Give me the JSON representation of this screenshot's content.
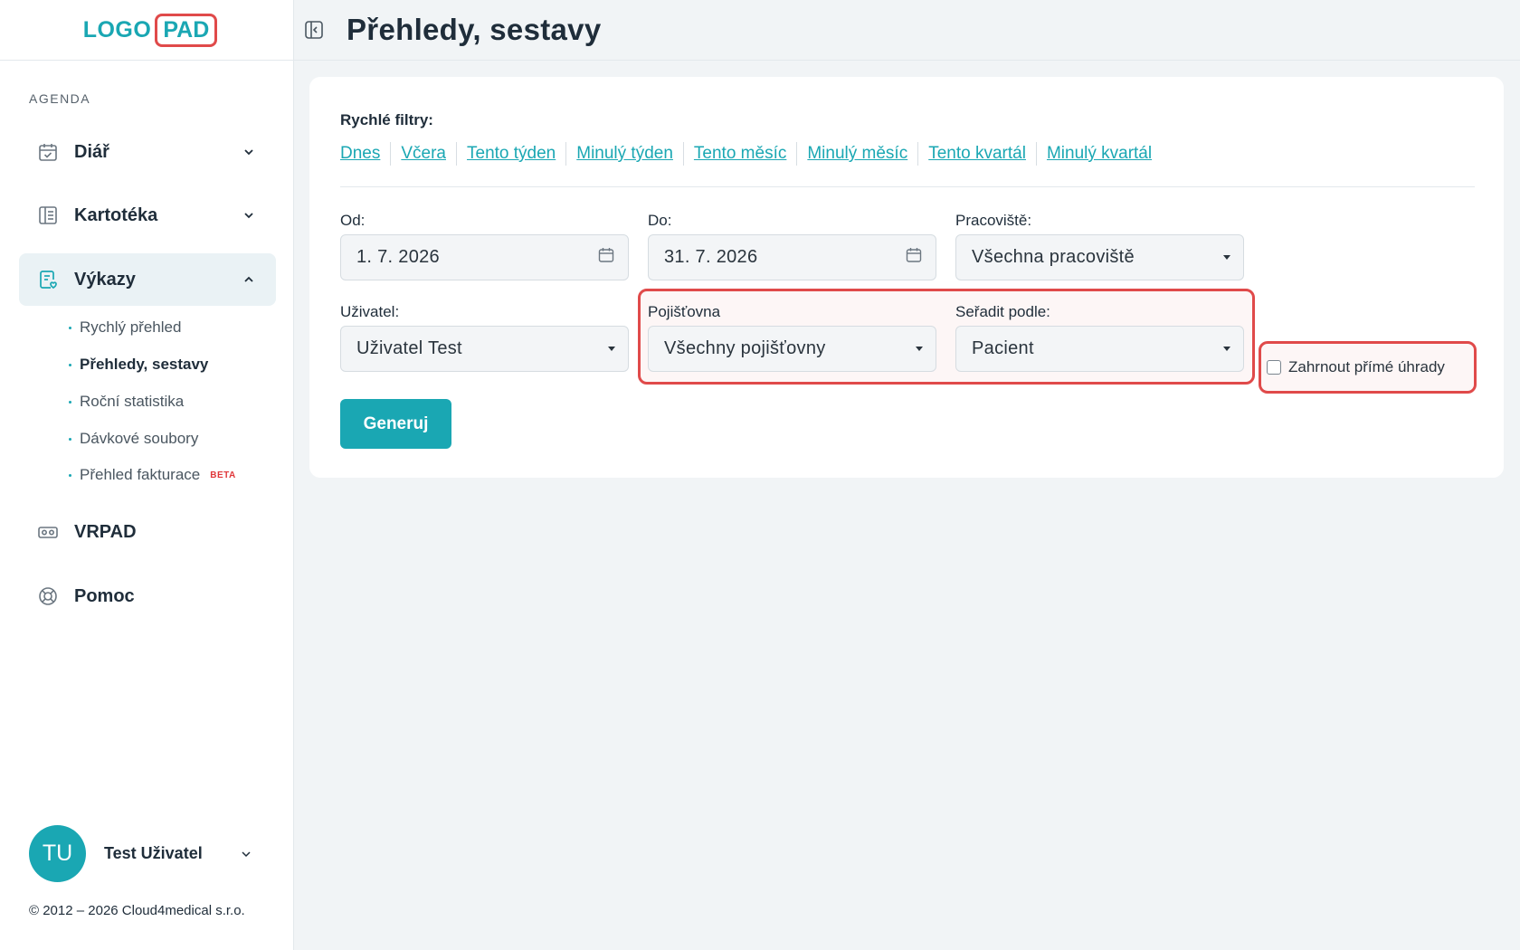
{
  "logo": {
    "left": "LOGO",
    "right": "PAD"
  },
  "header": {
    "title": "Přehledy, sestavy"
  },
  "sidebar": {
    "section_label": "AGENDA",
    "items": [
      {
        "label": "Diář",
        "icon": "calendar-check-icon"
      },
      {
        "label": "Kartotéka",
        "icon": "card-index-icon"
      },
      {
        "label": "Výkazy",
        "icon": "report-icon",
        "expanded": true
      },
      {
        "label": "VRPAD",
        "icon": "vr-headset-icon"
      },
      {
        "label": "Pomoc",
        "icon": "lifebuoy-icon"
      }
    ],
    "subitems": [
      {
        "label": "Rychlý přehled"
      },
      {
        "label": "Přehledy, sestavy",
        "current": true
      },
      {
        "label": "Roční statistika"
      },
      {
        "label": "Dávkové soubory"
      },
      {
        "label": "Přehled fakturace",
        "badge": "BETA"
      }
    ],
    "user": {
      "initials": "TU",
      "name": "Test Uživatel"
    },
    "copyright": "© 2012 – 2026 Cloud4medical s.r.o."
  },
  "filters": {
    "quick_label": "Rychlé filtry:",
    "quick": [
      "Dnes",
      "Včera",
      "Tento týden",
      "Minulý týden",
      "Tento měsíc",
      "Minulý měsíc",
      "Tento kvartál",
      "Minulý kvartál"
    ],
    "od": {
      "label": "Od:",
      "value": "1. 7. 2026"
    },
    "do": {
      "label": "Do:",
      "value": "31. 7. 2026"
    },
    "pracoviste": {
      "label": "Pracoviště:",
      "value": "Všechna pracoviště"
    },
    "uzivatel": {
      "label": "Uživatel:",
      "value": "Uživatel Test"
    },
    "pojistovna": {
      "label": "Pojišťovna",
      "value": "Všechny pojišťovny"
    },
    "seradit": {
      "label": "Seřadit podle:",
      "value": "Pacient"
    },
    "prime_uhrady": {
      "label": "Zahrnout přímé úhrady",
      "checked": false
    }
  },
  "actions": {
    "generate": "Generuj"
  },
  "colors": {
    "accent": "#1aa7b3",
    "highlight": "#e04a4a",
    "beta": "#e0373a"
  }
}
